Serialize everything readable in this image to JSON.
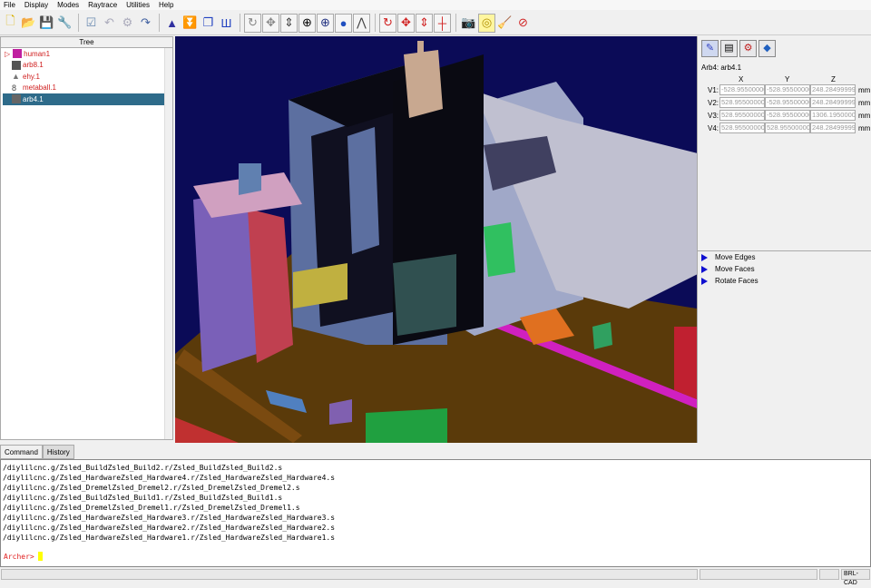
{
  "menu": [
    "File",
    "Display",
    "Modes",
    "Raytrace",
    "Utilities",
    "Help"
  ],
  "toolbar": {
    "icons": [
      "new-file",
      "open-folder",
      "save",
      "wrench",
      "checkbox-edit",
      "undo",
      "redo-gear",
      "cycle",
      "wizard-hat",
      "collapse-down",
      "layers",
      "wall",
      "rotate",
      "pan",
      "scale",
      "center-crosshair",
      "globe-view",
      "sphere-view",
      "compass",
      "rotate-red",
      "move-red",
      "scale-red",
      "center-red",
      "camera",
      "raytrace",
      "broom",
      "no-entry"
    ]
  },
  "tree": {
    "header": "Tree",
    "items": [
      {
        "label": "human1",
        "icon": "region-icon",
        "expandable": true
      },
      {
        "label": "arb8.1",
        "icon": "cube-icon"
      },
      {
        "label": "ehy.1",
        "icon": "cone-icon"
      },
      {
        "label": "metaball.1",
        "icon": "metaball-icon"
      },
      {
        "label": "arb4.1",
        "icon": "cube-icon",
        "selected": true
      }
    ]
  },
  "panel": {
    "title": "Arb4: arb4.1",
    "columns": [
      "X",
      "Y",
      "Z"
    ],
    "rows": [
      {
        "label": "V1:",
        "x": "-528.95500000",
        "y": "-528.95500000",
        "z": "248.28499999",
        "unit": "mm"
      },
      {
        "label": "V2:",
        "x": "528.95500000",
        "y": "-528.95500000",
        "z": "248.28499999",
        "unit": "mm"
      },
      {
        "label": "V3:",
        "x": "528.95500000",
        "y": "-528.95500000",
        "z": "1306.1950000",
        "unit": "mm"
      },
      {
        "label": "V4:",
        "x": "528.95500000",
        "y": "528.95500000",
        "z": "248.28499999",
        "unit": "mm"
      }
    ],
    "edit_modes": [
      "Move Edges",
      "Move Faces",
      "Rotate Faces"
    ]
  },
  "console": {
    "tabs": [
      "Command",
      "History"
    ],
    "lines": [
      "/diylilcnc.g/Zsled_BuildZsled_Build2.r/Zsled_BuildZsled_Build2.s",
      "/diylilcnc.g/Zsled_HardwareZsled_Hardware4.r/Zsled_HardwareZsled_Hardware4.s",
      "/diylilcnc.g/Zsled_DremelZsled_Dremel2.r/Zsled_DremelZsled_Dremel2.s",
      "/diylilcnc.g/Zsled_BuildZsled_Build1.r/Zsled_BuildZsled_Build1.s",
      "/diylilcnc.g/Zsled_DremelZsled_Dremel1.r/Zsled_DremelZsled_Dremel1.s",
      "/diylilcnc.g/Zsled_HardwareZsled_Hardware3.r/Zsled_HardwareZsled_Hardware3.s",
      "/diylilcnc.g/Zsled_HardwareZsled_Hardware2.r/Zsled_HardwareZsled_Hardware2.s",
      "/diylilcnc.g/Zsled_HardwareZsled_Hardware1.r/Zsled_HardwareZsled_Hardware1.s"
    ],
    "prompt": "Archer>"
  },
  "status": {
    "app": "BRL-CAD"
  }
}
